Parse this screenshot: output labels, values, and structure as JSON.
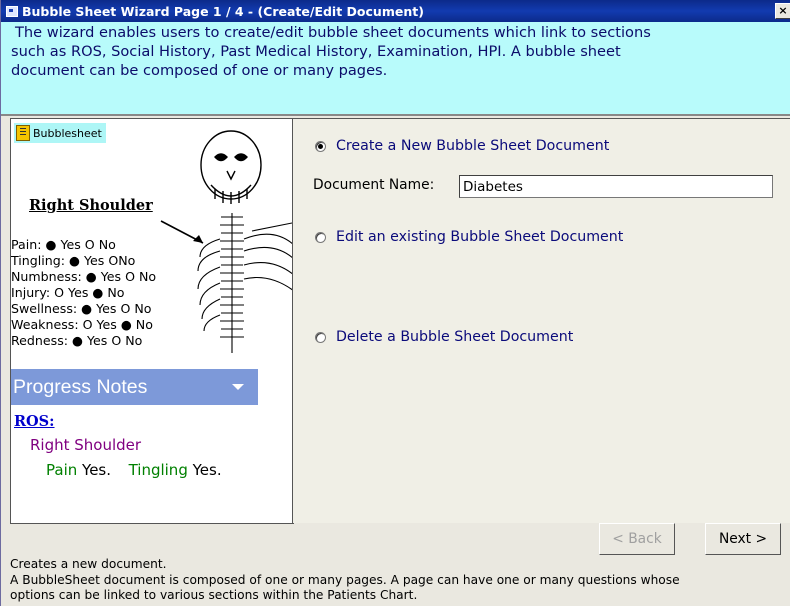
{
  "window": {
    "title": "Bubble Sheet Wizard Page 1 / 4 - (Create/Edit Document)",
    "close_glyph": "×"
  },
  "banner": {
    "line1": "The wizard enables users to create/edit bubble sheet documents which link to sections",
    "line2": "such as ROS, Social History, Past Medical History, Examination, HPI. A bubble sheet",
    "line3": "document can be composed of one or many pages."
  },
  "preview": {
    "chip_label": "Bubblesheet",
    "heading": "Right Shoulder",
    "symptoms": [
      "Pain: ● Yes O No",
      "Tingling: ● Yes  ONo",
      "Numbness: ● Yes O No",
      "Injury: O Yes ● No",
      "Swellness: ● Yes O No",
      "Weakness: O Yes ● No",
      "Redness: ● Yes O No"
    ],
    "progress_notes": "Progress Notes",
    "ros_link": "ROS:",
    "ros_section": "Right Shoulder",
    "ros_pain_label": "Pain",
    "ros_pain_value": "Yes.",
    "ros_tingling_label": "Tingling",
    "ros_tingling_value": "Yes."
  },
  "options": {
    "create_label": "Create a New Bubble Sheet Document",
    "document_name_label": "Document Name:",
    "document_name_value": "Diabetes",
    "edit_label": "Edit an existing Bubble Sheet Document",
    "delete_label": "Delete a  Bubble Sheet Document",
    "selected": "create"
  },
  "buttons": {
    "back_label": "< Back",
    "next_label": "Next >"
  },
  "footer": {
    "line1": "Creates a new document.",
    "line2": "A BubbleSheet document is composed of one or many pages. A page can have one or many questions whose",
    "line3": "options can be linked to various sections within the Patients Chart."
  },
  "colors": {
    "title_bar": "#123bb0",
    "banner_bg": "#b8fbfb",
    "banner_text": "#0c0c6a",
    "progress_notes_bar": "#7d99d9",
    "ros_link": "#0000cc",
    "ros_section": "#800080",
    "ros_symptom": "#008000"
  }
}
